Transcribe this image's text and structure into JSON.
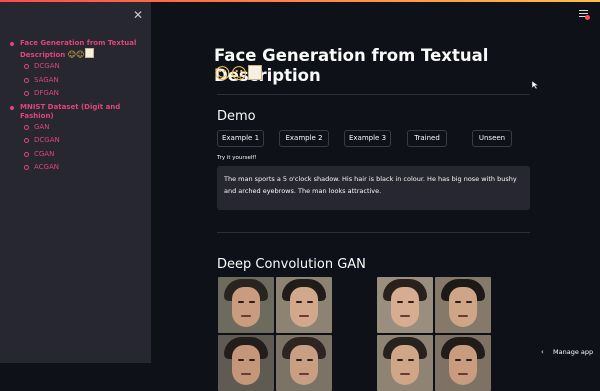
{
  "sidebar": {
    "close_icon": "close-icon",
    "nav": [
      {
        "label": "Face Generation from Textual Description",
        "emoji": "🧑‍🦰👨🗒",
        "children": [
          "DCGAN",
          "SAGAN",
          "DFGAN"
        ]
      },
      {
        "label": "MNIST Dataset (Digit and Fashion)",
        "emoji": "",
        "children": [
          "GAN",
          "DCGAN",
          "CGAN",
          "ACGAN"
        ]
      }
    ]
  },
  "main": {
    "title": "Face Generation from Textual Description",
    "title_emojis": "🧑‍🦰👨🗒",
    "menu_icon": "hamburger-icon",
    "demo_heading": "Demo",
    "buttons": [
      "Example 1",
      "Example 2",
      "Example 3",
      "Trained",
      "Unseen"
    ],
    "try_label": "Try it yourself!",
    "textarea_value": "The man sports a 5 o'clock shadow. His hair is black in colour. He has big nose with bushy and arched eyebrows. The man looks attractive.",
    "dcgan_heading": "Deep Convolution GAN"
  },
  "footer": {
    "manage_app": "Manage app"
  },
  "colors": {
    "bg": "#0e1117",
    "sidebar": "#262730",
    "accent": "#e0457b"
  }
}
